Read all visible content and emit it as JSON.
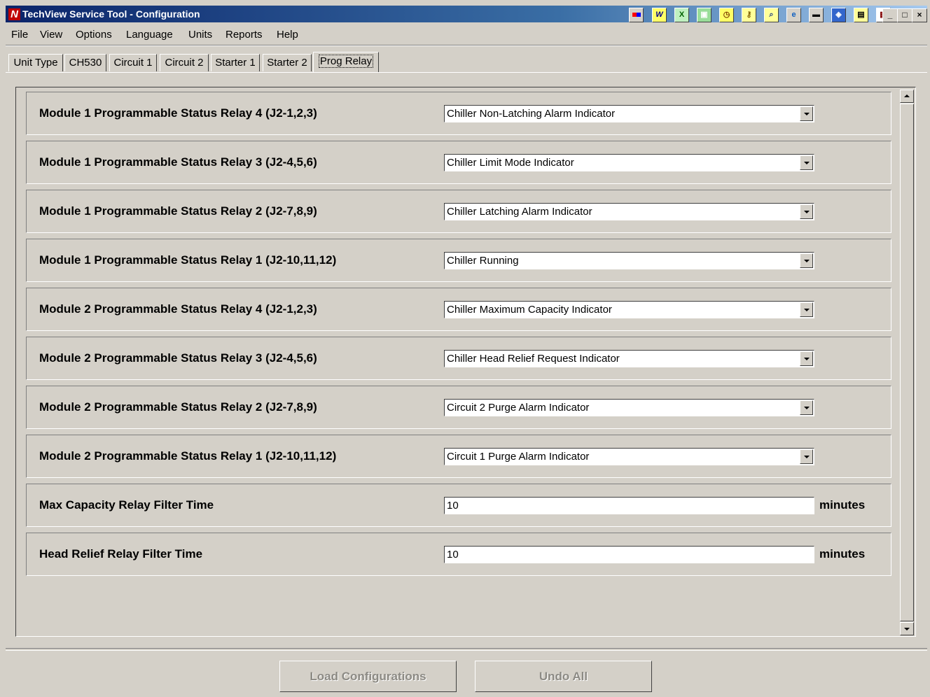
{
  "window": {
    "title": "TechView Service Tool - Configuration",
    "logo_letter": "N",
    "controls": {
      "minimize": "_",
      "maximize": "□",
      "close": "×"
    }
  },
  "tray_icons": [
    "app-icon",
    "w-icon",
    "excel-icon",
    "monitor-icon",
    "clock-icon",
    "key-icon",
    "magnify-icon",
    "ie-icon",
    "terminal-icon",
    "net-icon",
    "window-icon",
    "calc-icon"
  ],
  "menu": [
    "File",
    "View",
    "Options",
    "Language",
    "Units",
    "Reports",
    "Help"
  ],
  "tabs": [
    "Unit Type",
    "CH530",
    "Circuit 1",
    "Circuit 2",
    "Starter 1",
    "Starter 2",
    "Prog Relay"
  ],
  "active_tab": "Prog Relay",
  "rows": [
    {
      "label": "Module 1 Programmable Status Relay 4 (J2-1,2,3)",
      "value": "Chiller Non-Latching Alarm Indicator"
    },
    {
      "label": "Module 1 Programmable Status Relay 3 (J2-4,5,6)",
      "value": "Chiller Limit Mode Indicator"
    },
    {
      "label": "Module 1 Programmable Status Relay 2 (J2-7,8,9)",
      "value": "Chiller Latching Alarm Indicator"
    },
    {
      "label": "Module 1 Programmable Status Relay 1 (J2-10,11,12)",
      "value": "Chiller Running"
    },
    {
      "label": "Module 2 Programmable Status Relay 4 (J2-1,2,3)",
      "value": "Chiller Maximum Capacity Indicator"
    },
    {
      "label": "Module 2 Programmable Status Relay 3 (J2-4,5,6)",
      "value": "Chiller Head Relief Request Indicator"
    },
    {
      "label": "Module 2 Programmable Status Relay 2 (J2-7,8,9)",
      "value": "Circuit 2 Purge Alarm Indicator"
    },
    {
      "label": "Module 2 Programmable Status Relay 1 (J2-10,11,12)",
      "value": "Circuit 1 Purge Alarm Indicator"
    }
  ],
  "filters": [
    {
      "label": "Max Capacity Relay Filter Time",
      "value": "10",
      "unit": "minutes"
    },
    {
      "label": "Head Relief Relay Filter Time",
      "value": "10",
      "unit": "minutes"
    }
  ],
  "buttons": {
    "load": "Load Configurations",
    "undo": "Undo All"
  }
}
